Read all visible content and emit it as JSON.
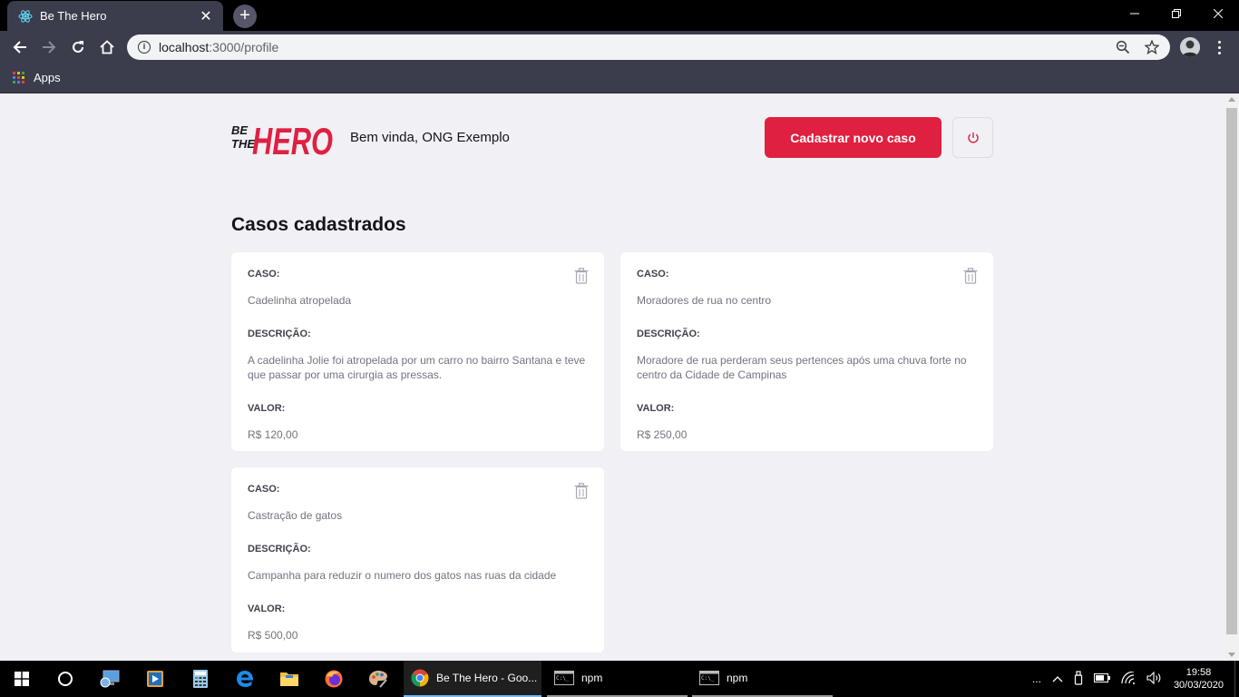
{
  "browser": {
    "tab_title": "Be The Hero",
    "tab_close": "✕",
    "new_tab": "+",
    "url_host": "localhost",
    "url_rest": ":3000/profile",
    "bookmarks": {
      "apps_label": "Apps"
    }
  },
  "header": {
    "welcome": "Bem vinda, ONG Exemplo",
    "new_case_label": "Cadastrar novo caso",
    "brand_color": "#e02041"
  },
  "main": {
    "title": "Casos cadastrados",
    "cases": [
      {
        "case_label": "CASO:",
        "case": "Cadelinha atropelada",
        "description_label": "DESCRIÇÃO:",
        "description": "A cadelinha Jolie foi atropelada por um carro no bairro Santana e teve que passar por uma cirurgia as pressas.",
        "value_label": "VALOR:",
        "value": "R$ 120,00"
      },
      {
        "case_label": "CASO:",
        "case": "Moradores de rua no centro",
        "description_label": "DESCRIÇÃO:",
        "description": "Moradore de rua perderam seus pertences após uma chuva forte no centro da Cidade de Campinas",
        "value_label": "VALOR:",
        "value": "R$ 250,00"
      },
      {
        "case_label": "CASO:",
        "case": "Castração de gatos",
        "description_label": "DESCRIÇÃO:",
        "description": "Campanha para reduzir o numero dos gatos nas ruas da cidade",
        "value_label": "VALOR:",
        "value": "R$ 500,00"
      }
    ]
  },
  "taskbar": {
    "chrome_label": "Be The Hero - Goo...",
    "npm1_label": "npm",
    "npm2_label": "npm",
    "time": "19:58",
    "date": "30/03/2020",
    "overflow": "..."
  }
}
